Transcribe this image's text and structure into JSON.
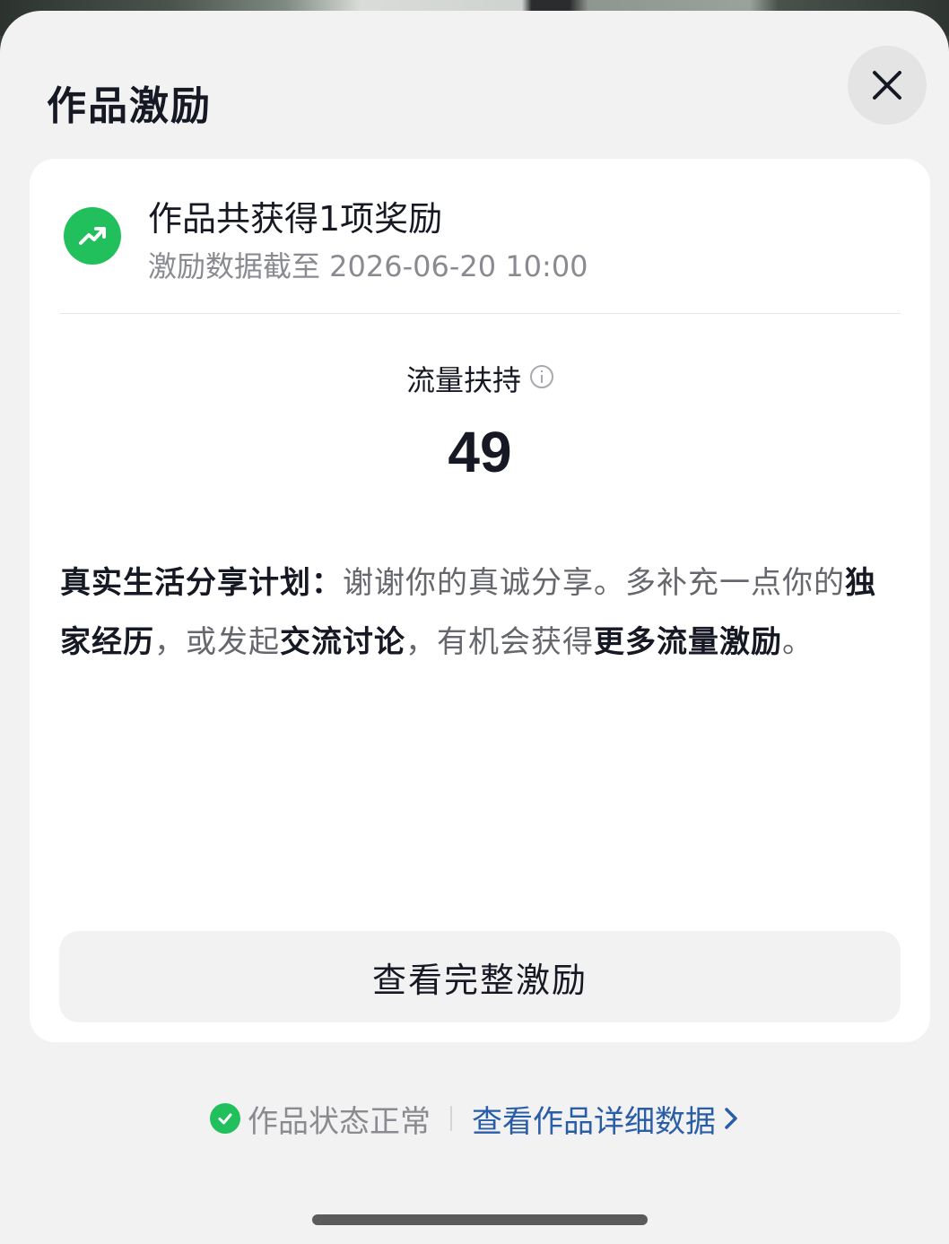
{
  "sheet": {
    "title": "作品激励",
    "close_icon": "close-icon"
  },
  "card": {
    "icon": "trend-up-icon",
    "headline": "作品共获得1项奖励",
    "subline": "激励数据截至 2026-06-20 10:00",
    "metric": {
      "label": "流量扶持",
      "value": "49",
      "info_icon": "info-icon"
    },
    "description": {
      "parts": [
        {
          "text": "真实生活分享计划：",
          "bold": true
        },
        {
          "text": "谢谢你的真诚分享。多补充一点你的",
          "bold": false
        },
        {
          "text": "独家经历",
          "bold": true
        },
        {
          "text": "，或发起",
          "bold": false
        },
        {
          "text": "交流讨论",
          "bold": true
        },
        {
          "text": "，有机会获得",
          "bold": false
        },
        {
          "text": "更多流量激励",
          "bold": true
        },
        {
          "text": "。",
          "bold": false
        }
      ]
    },
    "button_label": "查看完整激励"
  },
  "footer": {
    "status_icon": "check-circle-icon",
    "status_text": "作品状态正常",
    "link_text": "查看作品详细数据",
    "link_icon": "chevron-right-icon"
  },
  "colors": {
    "accent_green": "#22c05c",
    "link_blue": "#2a5da8",
    "text_primary": "#161823",
    "text_secondary": "#8a8b91"
  }
}
